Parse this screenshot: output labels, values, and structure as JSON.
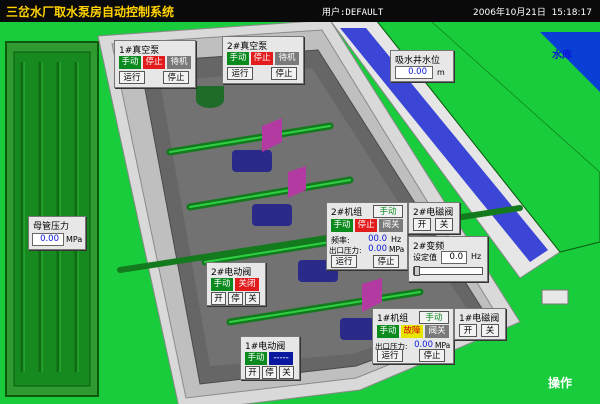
{
  "titlebar": {
    "app_title": "三岔水厂取水泵房自动控制系统",
    "user": "用户:DEFAULT",
    "date": "2006年10月21日",
    "time": "15:18:17"
  },
  "labels": {
    "reservoir": "水库",
    "operate": "操作"
  },
  "vacuum_pump_1": {
    "title": "1#真空泵",
    "mode": "手动",
    "status_stop": "停止",
    "status_standby": "待机",
    "run_label": "运行",
    "stop_label": "停止"
  },
  "vacuum_pump_2": {
    "title": "2#真空泵",
    "mode": "手动",
    "status_stop": "停止",
    "status_standby": "待机",
    "run_label": "运行",
    "stop_label": "停止"
  },
  "suction_level": {
    "title": "吸水井水位",
    "value": "0.00",
    "unit": "m"
  },
  "header_pressure": {
    "title": "母管压力",
    "value": "0.00",
    "unit": "MPa"
  },
  "unit_2": {
    "title": "2#机组",
    "mode": "手动",
    "status_mode": "手动",
    "status_stop": "停止",
    "status_valve": "阀关",
    "freq_label": "频率:",
    "freq_value": "00.0",
    "freq_unit": "Hz",
    "pressure_label": "出口压力:",
    "pressure_value": "0.00",
    "pressure_unit": "MPa",
    "run_label": "运行",
    "stop_label": "停止"
  },
  "solenoid_2": {
    "title": "2#电磁阀",
    "open_label": "开",
    "close_label": "关"
  },
  "vfd_2": {
    "title": "2#变频",
    "setpoint_label": "设定值",
    "setpoint_value": "0.0",
    "unit": "Hz"
  },
  "elec_valve_2": {
    "title": "2#电动阀",
    "mode": "手动",
    "status": "关闭",
    "open_label": "开",
    "stop_label": "停",
    "close_label": "关"
  },
  "unit_1": {
    "title": "1#机组",
    "mode": "手动",
    "status_mode": "手动",
    "status_fault": "故障",
    "status_valve": "阀关",
    "pressure_label": "出口压力:",
    "pressure_value": "0.00",
    "pressure_unit": "MPa",
    "run_label": "运行",
    "stop_label": "停止"
  },
  "solenoid_1": {
    "title": "1#电磁阀",
    "open_label": "开",
    "close_label": "关"
  },
  "elec_valve_1": {
    "title": "1#电动阀",
    "mode": "手动",
    "status": "-----",
    "open_label": "开",
    "stop_label": "停",
    "close_label": "关"
  }
}
